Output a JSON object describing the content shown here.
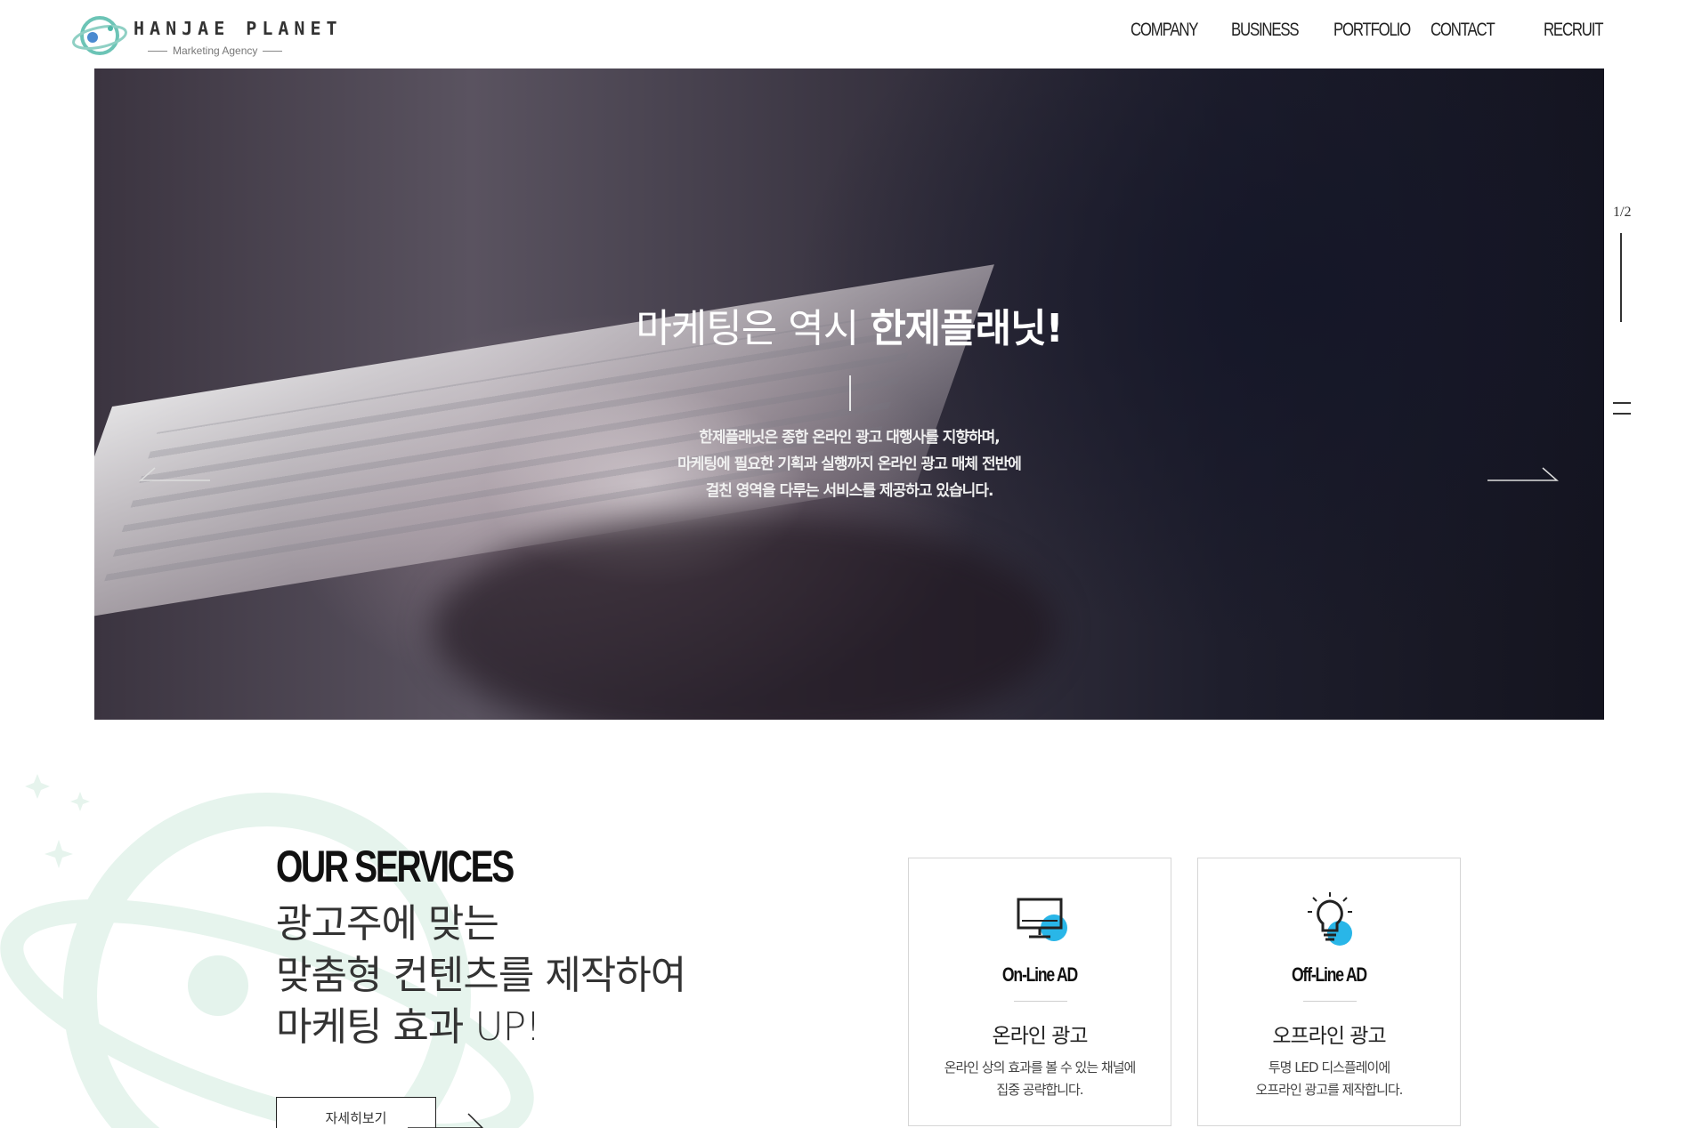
{
  "header": {
    "logo_title": "HANJAE PLANET",
    "logo_subtitle": "Marketing Agency",
    "nav": [
      "COMPANY",
      "BUSINESS",
      "PORTFOLIO",
      "CONTACT",
      "RECRUIT"
    ]
  },
  "hero": {
    "title_regular": "마케팅은 역시 ",
    "title_bold": "한제플래닛!",
    "description_lines": [
      "한제플래닛은 종합 온라인 광고 대행사를 지향하며,",
      "마케팅에 필요한 기획과 실행까지 온라인 광고 매체 전반에",
      "걸친 영역을 다루는 서비스를 제공하고 있습니다."
    ],
    "slide_counter": "1/2"
  },
  "services": {
    "heading": "OUR SERVICES",
    "lines": [
      "광고주에 맞는",
      "맞춤형 컨텐츠를 제작하여",
      "마케팅 효과 UP!"
    ],
    "more_label": "자세히보기",
    "cards": [
      {
        "title": "On-Line AD",
        "subtitle": "온라인 광고",
        "desc_lines": [
          "온라인 상의 효과를 볼 수 있는 채널에",
          "집중 공략합니다."
        ],
        "icon": "monitor-icon"
      },
      {
        "title": "Off-Line AD",
        "subtitle": "오프라인 광고",
        "desc_lines": [
          "투명 LED 디스플레이에",
          "오프라인 광고를 제작합니다."
        ],
        "icon": "lightbulb-icon"
      }
    ]
  },
  "colors": {
    "accent": "#29b6e8",
    "logo_teal": "#4fb8a8",
    "planet_mint": "#e4f3ec"
  }
}
